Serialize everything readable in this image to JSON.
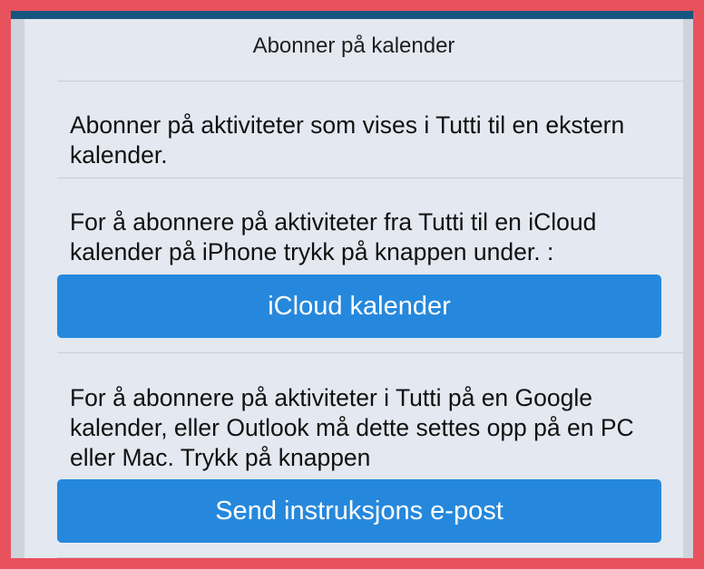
{
  "sheet": {
    "title": "Abonner på kalender",
    "intro": "Abonner på aktiviteter som vises i Tutti til en ekstern kalender.",
    "icloud_text": "For å abonnere på aktiviteter fra Tutti til en iCloud kalender på iPhone trykk på knappen under. :",
    "icloud_button": "iCloud kalender",
    "google_text": "For å abonnere på aktiviteter i Tutti på en Google kalender, eller Outlook må dette settes opp på en PC eller Mac. Trykk på knappen",
    "email_button": "Send instruksjons e-post"
  },
  "colors": {
    "background": "#16557f",
    "highlight_border": "#e8525c",
    "sheet": "#e4e8f0",
    "button": "#2688dc"
  }
}
